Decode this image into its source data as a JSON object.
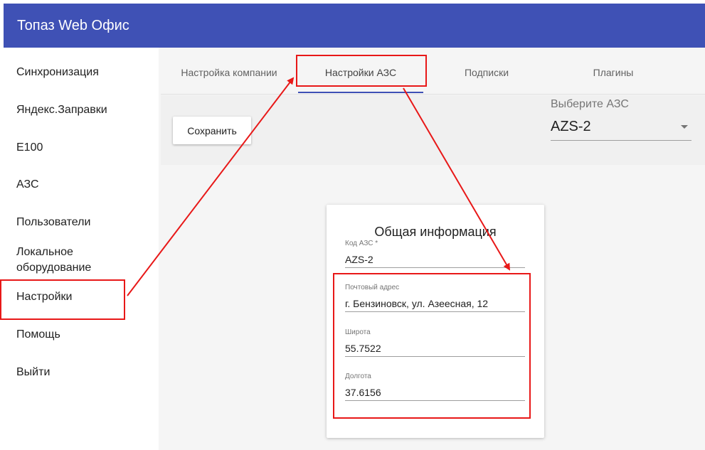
{
  "app": {
    "title": "Топаз Web Офис"
  },
  "sidebar": {
    "items": [
      {
        "label": "Синхронизация"
      },
      {
        "label": "Яндекс.Заправки"
      },
      {
        "label": "E100"
      },
      {
        "label": "АЗС"
      },
      {
        "label": "Пользователи"
      },
      {
        "label": "Локальное оборудование"
      },
      {
        "label": "Настройки",
        "highlighted": true
      },
      {
        "label": "Помощь"
      },
      {
        "label": "Выйти"
      }
    ]
  },
  "tabs": {
    "items": [
      {
        "label": "Настройка компании"
      },
      {
        "label": "Настройки АЗС",
        "active": true,
        "highlighted": true
      },
      {
        "label": "Подписки"
      },
      {
        "label": "Плагины"
      }
    ]
  },
  "toolbar": {
    "save_label": "Сохранить",
    "station_select": {
      "label": "Выберите АЗС",
      "value": "AZS-2"
    }
  },
  "card": {
    "title": "Общая информация",
    "fields": [
      {
        "label": "Код АЗС *",
        "value": "AZS-2"
      },
      {
        "label": "Почтовый адрес",
        "value": "г. Бензиновск, ул. Азеесная, 12"
      },
      {
        "label": "Широта",
        "value": "55.7522"
      },
      {
        "label": "Долгота",
        "value": "37.6156"
      }
    ]
  },
  "colors": {
    "header": "#3f51b5",
    "tab_indicator": "#3f51b5",
    "annotation": "#e81818"
  },
  "icons": {
    "select_arrow": "caret-down-icon"
  }
}
